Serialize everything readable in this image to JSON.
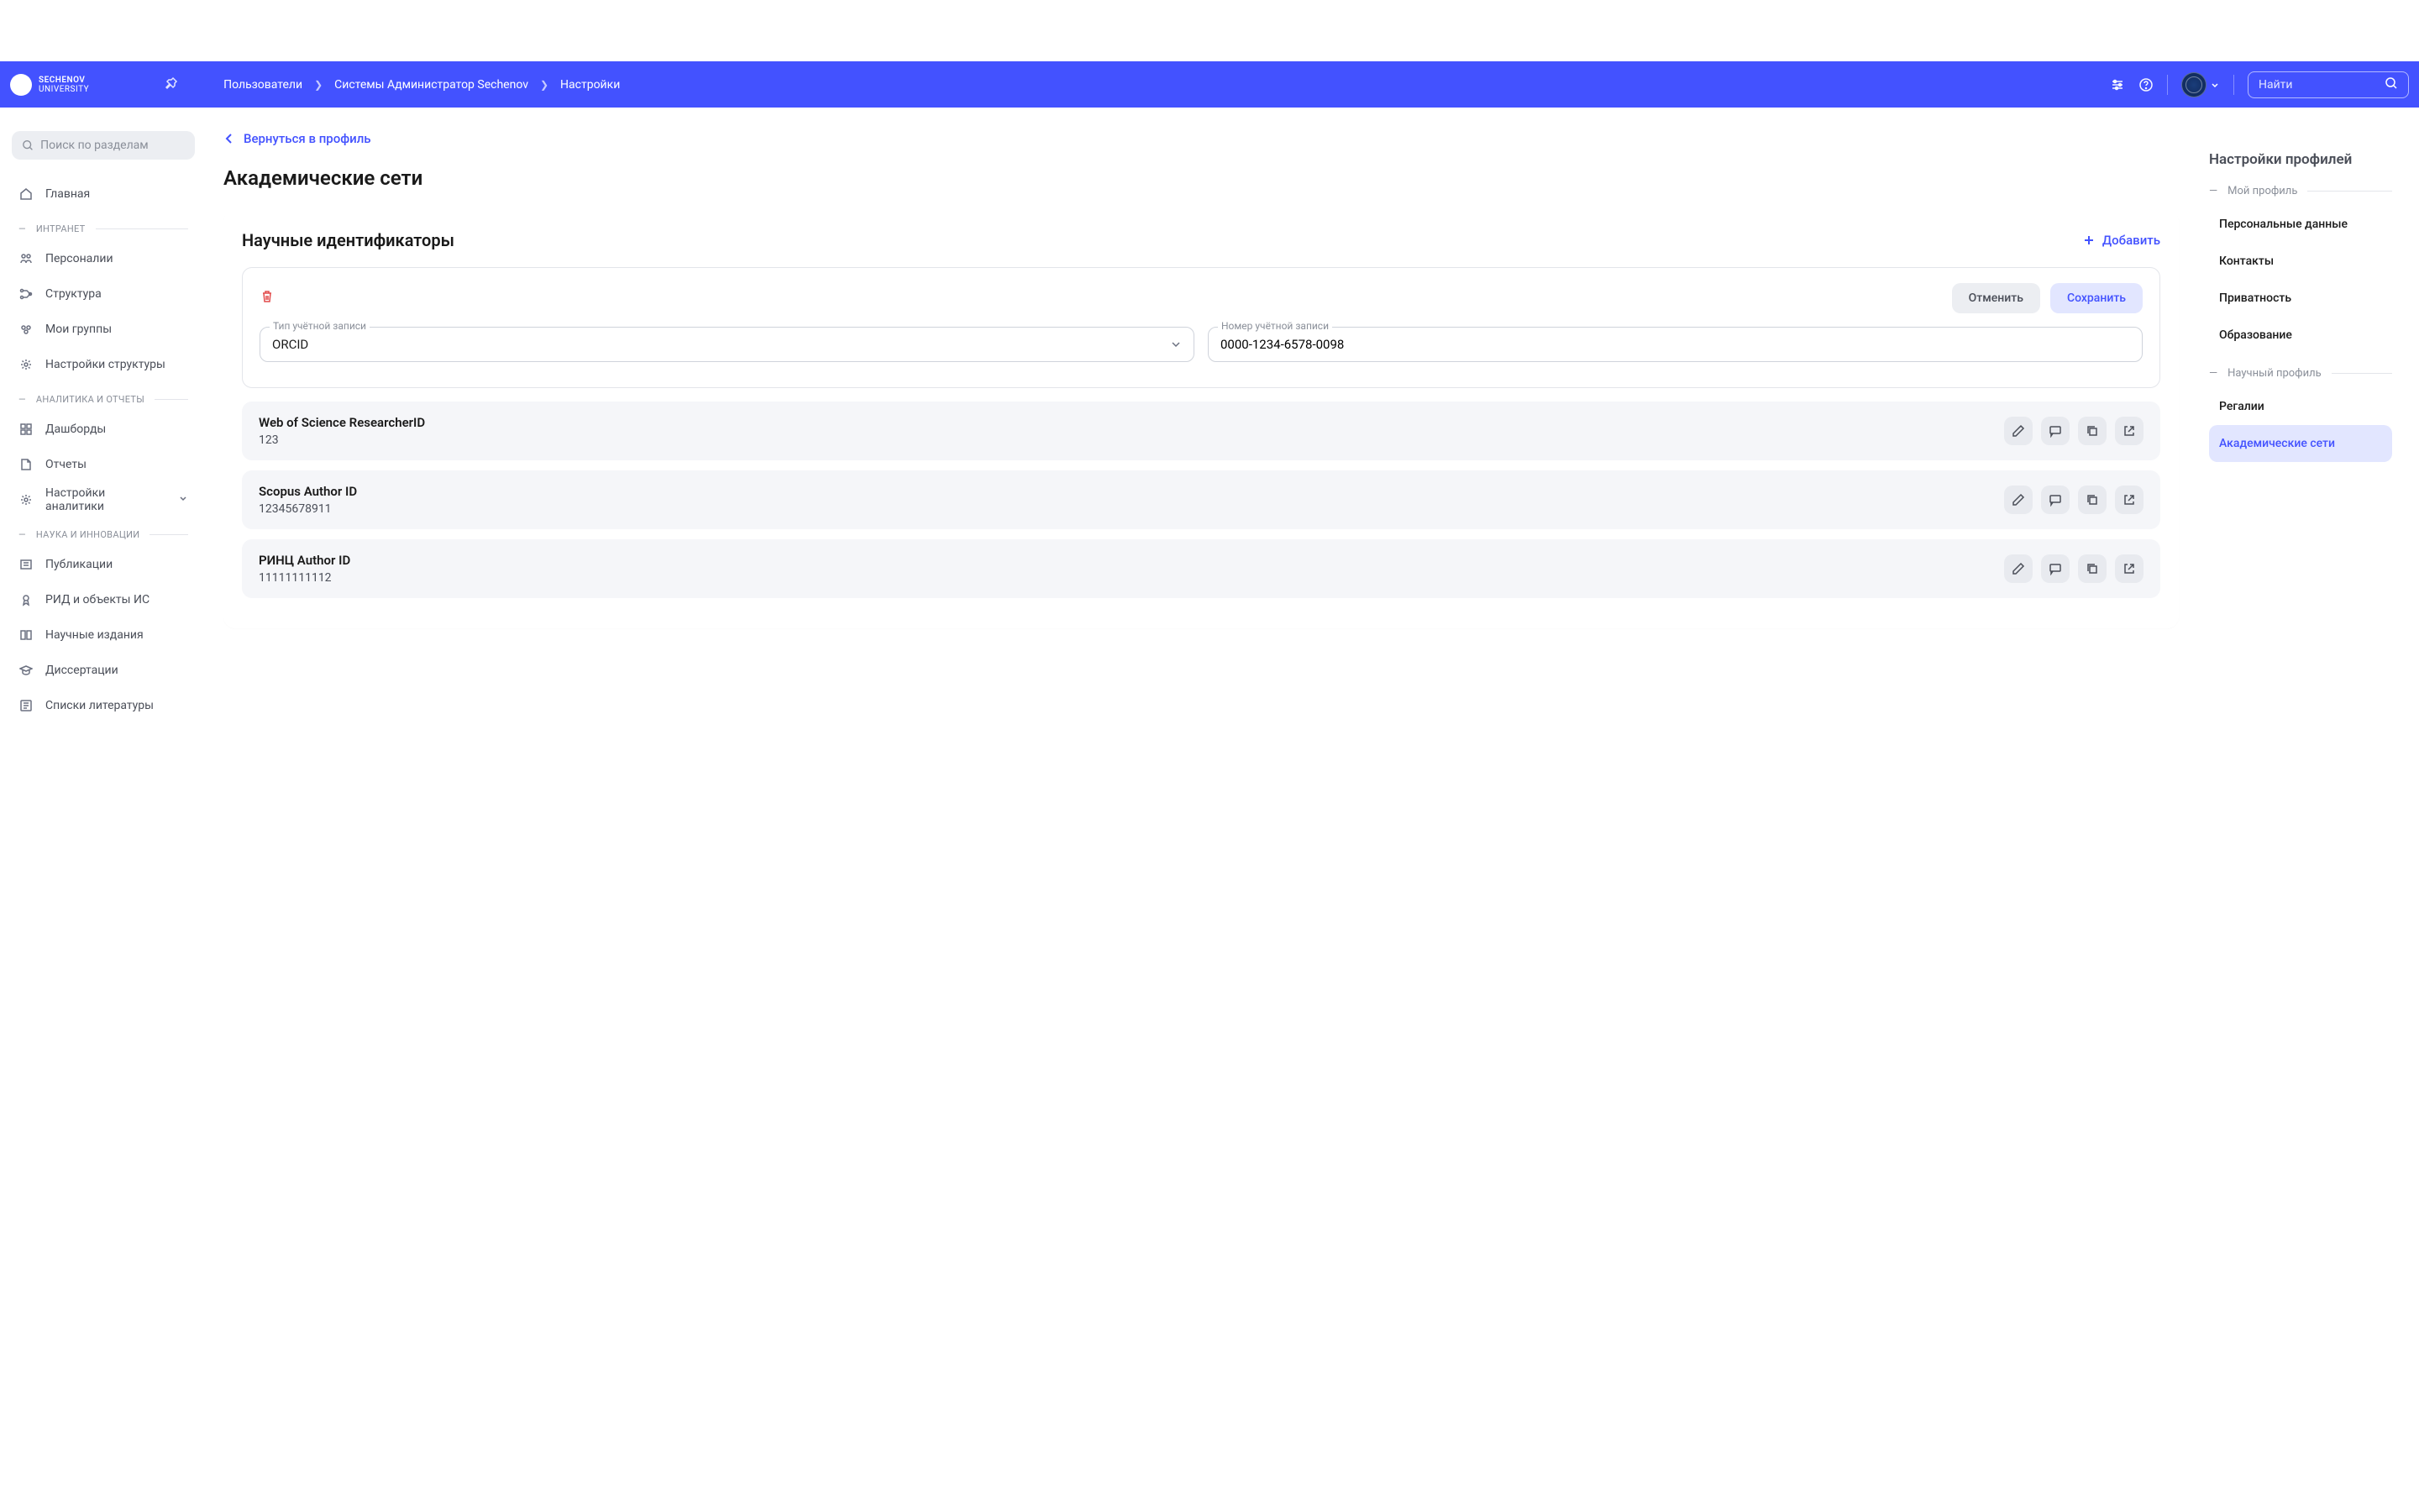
{
  "header": {
    "logo_top": "SECHENOV",
    "logo_bot": "UNIVERSITY",
    "breadcrumb": [
      "Пользователи",
      "Системы Администратор Sechenov",
      "Настройки"
    ],
    "search_placeholder": "Найти"
  },
  "sidebar": {
    "search_placeholder": "Поиск по разделам",
    "items": [
      {
        "label": "Главная",
        "icon": "home"
      }
    ],
    "sections": [
      {
        "title": "ИНТРАНЕТ",
        "items": [
          {
            "label": "Персоналии",
            "icon": "people"
          },
          {
            "label": "Структура",
            "icon": "structure"
          },
          {
            "label": "Мои группы",
            "icon": "groups"
          },
          {
            "label": "Настройки структуры",
            "icon": "gear"
          }
        ]
      },
      {
        "title": "АНАЛИТИКА И ОТЧЕТЫ",
        "items": [
          {
            "label": "Дашборды",
            "icon": "dashboard"
          },
          {
            "label": "Отчеты",
            "icon": "reports"
          },
          {
            "label": "Настройки аналитики",
            "icon": "gear",
            "expandable": true
          }
        ]
      },
      {
        "title": "НАУКА И ИННОВАЦИИ",
        "items": [
          {
            "label": "Публикации",
            "icon": "pub"
          },
          {
            "label": "РИД и объекты ИС",
            "icon": "award"
          },
          {
            "label": "Научные издания",
            "icon": "journal"
          },
          {
            "label": "Диссертации",
            "icon": "grad"
          },
          {
            "label": "Списки литературы",
            "icon": "list"
          }
        ]
      }
    ]
  },
  "main": {
    "back_label": "Вернуться в профиль",
    "page_title": "Академические сети",
    "card_title": "Научные идентификаторы",
    "add_label": "Добавить",
    "cancel_label": "Отменить",
    "save_label": "Сохранить",
    "account_type_label": "Тип учётной записи",
    "account_type_value": "ORCID",
    "account_number_label": "Номер учётной записи",
    "account_number_value": "0000-1234-6578-0098",
    "identifiers": [
      {
        "name": "Web of Science ResearcherID",
        "value": "123"
      },
      {
        "name": "Scopus Author ID",
        "value": "12345678911"
      },
      {
        "name": "РИНЦ Author ID",
        "value": "11111111112"
      }
    ]
  },
  "right_panel": {
    "title": "Настройки профилей",
    "sections": [
      {
        "title": "Мой профиль",
        "items": [
          {
            "label": "Персональные данные"
          },
          {
            "label": "Контакты"
          },
          {
            "label": "Приватность"
          },
          {
            "label": "Образование"
          }
        ]
      },
      {
        "title": "Научный профиль",
        "items": [
          {
            "label": "Регалии"
          },
          {
            "label": "Академические сети",
            "active": true
          }
        ]
      }
    ]
  }
}
